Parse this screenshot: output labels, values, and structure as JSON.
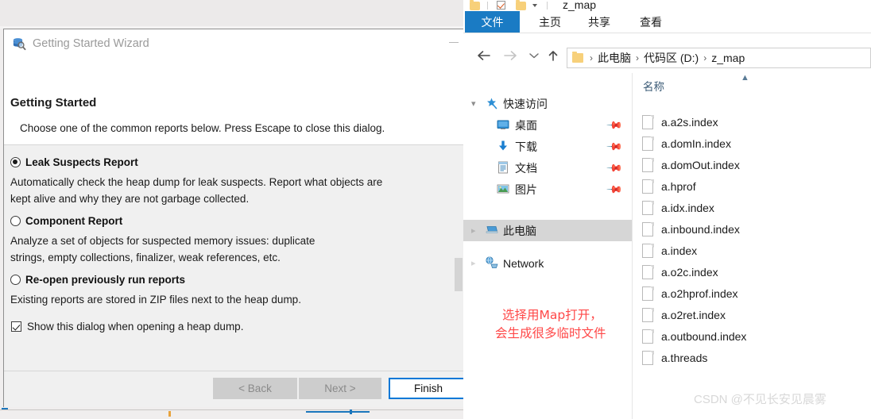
{
  "background_window": {
    "present": true
  },
  "wizard": {
    "titlebar": {
      "icon": "heap-dump-search-icon",
      "title": "Getting Started Wizard",
      "minimize": "minimize-icon"
    },
    "header": {
      "title": "Getting Started",
      "description": "Choose one of the common reports below. Press Escape to close this dialog."
    },
    "options": [
      {
        "label": "Leak Suspects Report",
        "selected": true,
        "description": "Automatically check the heap dump for leak suspects. Report what objects are kept alive and why they are not garbage collected."
      },
      {
        "label": "Component Report",
        "selected": false,
        "description": "Analyze a set of objects for suspected memory issues: duplicate strings, empty collections, finalizer, weak references, etc."
      },
      {
        "label": "Re-open previously run reports",
        "selected": false,
        "description": "Existing reports are stored in ZIP files next to the heap dump."
      }
    ],
    "checkbox": {
      "label": "Show this dialog when opening a heap dump.",
      "checked": true
    },
    "buttons": {
      "back": {
        "label": "< Back",
        "enabled": false
      },
      "next": {
        "label": "Next >",
        "enabled": false
      },
      "finish": {
        "label": "Finish",
        "enabled": true,
        "default": true
      }
    }
  },
  "explorer": {
    "window_name": "z_map",
    "quick_access_icons": [
      "folder-icon",
      "save-checkbox-icon",
      "folder-icon",
      "chevron-down-icon"
    ],
    "ribbon_tabs": [
      {
        "label": "文件",
        "active": true
      },
      {
        "label": "主页",
        "active": false
      },
      {
        "label": "共享",
        "active": false
      },
      {
        "label": "查看",
        "active": false
      }
    ],
    "nav_buttons": {
      "back": "back-arrow-icon",
      "forward": "forward-arrow-icon",
      "recent": "chevron-down-icon",
      "up": "up-arrow-icon"
    },
    "address_bar": {
      "folder_icon": "folder-icon",
      "crumbs": [
        "此电脑",
        "代码区 (D:)",
        "z_map"
      ],
      "separator": "›"
    },
    "nav_pane": [
      {
        "label": "快速访问",
        "icon": "star-pin-icon",
        "chevron": "expanded",
        "indent": 0,
        "pinned": false,
        "selected": false
      },
      {
        "label": "桌面",
        "icon": "desktop-icon",
        "indent": 1,
        "pinned": true,
        "selected": false
      },
      {
        "label": "下载",
        "icon": "download-icon",
        "indent": 1,
        "pinned": true,
        "selected": false
      },
      {
        "label": "文档",
        "icon": "documents-icon",
        "indent": 1,
        "pinned": true,
        "selected": false
      },
      {
        "label": "图片",
        "icon": "pictures-icon",
        "indent": 1,
        "pinned": true,
        "selected": false
      },
      {
        "label": "此电脑",
        "icon": "this-pc-icon",
        "chevron": "collapsed",
        "indent": 0,
        "pinned": false,
        "selected": true
      },
      {
        "label": "Network",
        "icon": "network-icon",
        "chevron": "collapsed",
        "indent": 0,
        "pinned": false,
        "selected": false
      }
    ],
    "list_header": {
      "column": "名称",
      "sort_indicator": "caret-up-icon"
    },
    "files": [
      {
        "name": "a.a2s.index",
        "icon": "file-icon"
      },
      {
        "name": "a.domIn.index",
        "icon": "file-icon"
      },
      {
        "name": "a.domOut.index",
        "icon": "file-icon"
      },
      {
        "name": "a.hprof",
        "icon": "file-icon"
      },
      {
        "name": "a.idx.index",
        "icon": "file-icon"
      },
      {
        "name": "a.inbound.index",
        "icon": "file-icon"
      },
      {
        "name": "a.index",
        "icon": "file-icon"
      },
      {
        "name": "a.o2c.index",
        "icon": "file-icon"
      },
      {
        "name": "a.o2hprof.index",
        "icon": "file-icon"
      },
      {
        "name": "a.o2ret.index",
        "icon": "file-icon"
      },
      {
        "name": "a.outbound.index",
        "icon": "file-icon"
      },
      {
        "name": "a.threads",
        "icon": "file-icon"
      }
    ]
  },
  "annotation": {
    "line1": "选择用Map打开，",
    "line2": "会生成很多临时文件",
    "color": "#ff4848"
  },
  "watermark": {
    "text": "CSDN @不见长安见晨雾",
    "color": "#d8d8d8"
  }
}
